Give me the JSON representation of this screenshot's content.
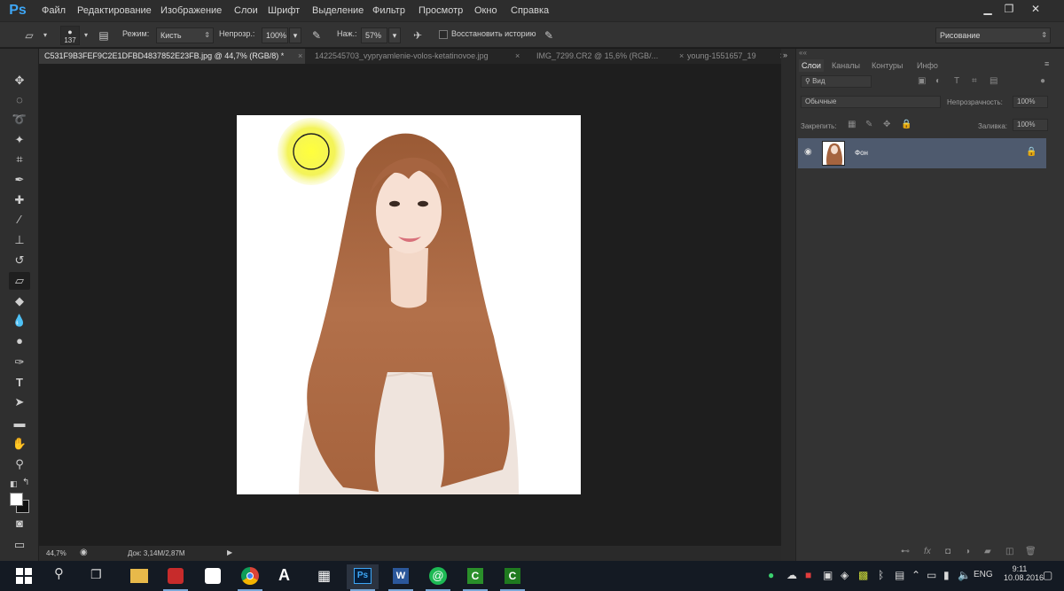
{
  "app": {
    "logo": "Ps"
  },
  "menu": [
    "Файл",
    "Редактирование",
    "Изображение",
    "Слои",
    "Шрифт",
    "Выделение",
    "Фильтр",
    "Просмотр",
    "Окно",
    "Справка"
  ],
  "options": {
    "brush_size": "137",
    "mode_label": "Режим:",
    "mode_value": "Кисть",
    "opacity_label": "Непрозр.:",
    "opacity_value": "100%",
    "flow_label": "Наж.:",
    "flow_value": "57%",
    "history_label": "Восстановить историю",
    "workspace": "Рисование"
  },
  "tabs": [
    {
      "label": "C531F9B3FEF9C2E1DFBD4837852E23FB.jpg @ 44,7% (RGB/8) *",
      "active": true
    },
    {
      "label": "1422545703_vypryamlenie-volos-ketatinovoe.jpg",
      "active": false
    },
    {
      "label": "IMG_7299.CR2 @ 15,6% (RGB/...",
      "active": false
    },
    {
      "label": "young-1551657_19",
      "active": false
    }
  ],
  "tabs_overflow": ">>",
  "status": {
    "zoom": "44,7%",
    "doc": "Док: 3,14M/2,87M"
  },
  "panel": {
    "tabs": [
      "Слои",
      "Каналы",
      "Контуры",
      "Инфо"
    ],
    "filter_placeholder": "Вид",
    "blend_mode": "Обычные",
    "opacity_label": "Непрозрачность:",
    "opacity_value": "100%",
    "lock_label": "Закрепить:",
    "fill_label": "Заливка:",
    "fill_value": "100%",
    "layer_name": "Фон"
  },
  "taskbar": {
    "lang": "ENG",
    "time": "9:11",
    "date": "10.08.2016"
  },
  "colors": {
    "brush_cursor": "#ffff3c",
    "layer_selected": "#4e5a6e",
    "ps_blue": "#3ea7f6"
  }
}
